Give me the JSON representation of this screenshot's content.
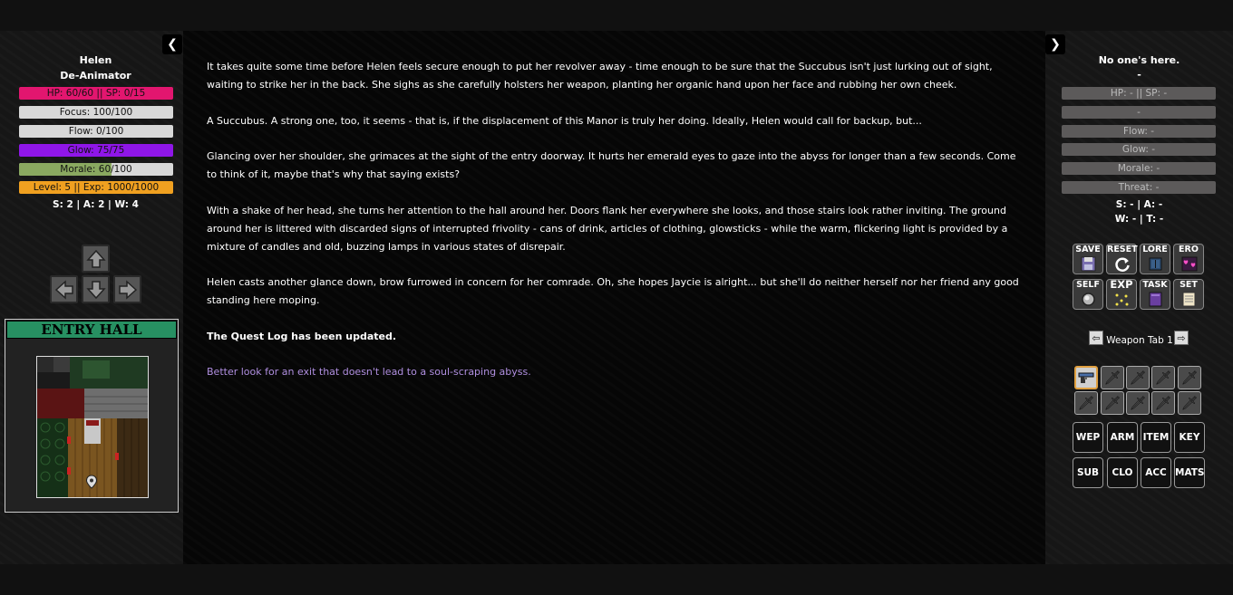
{
  "player": {
    "name": "Helen",
    "title": "De-Animator",
    "hp_sp": "HP: 60/60 || SP: 0/15",
    "focus": "Focus: 100/100",
    "flow": "Flow: 0/100",
    "glow": "Glow: 75/75",
    "morale": "Morale: 60/100",
    "level_exp": "Level: 5 || Exp: 1000/1000",
    "stats": "S: 2 | A: 2 | W: 4",
    "morale_fraction": 0.6,
    "colors": {
      "hp": "#e2166f",
      "focus": "#d8d8d8",
      "flow": "#d8d8d8",
      "glow": "#8f16e8",
      "morale": "#8aa960",
      "level": "#f0a020"
    }
  },
  "map": {
    "title": "ENTRY HALL"
  },
  "story": {
    "paragraphs": [
      "It takes quite some time before Helen feels secure enough to put her revolver away - time enough to be sure that the Succubus isn't just lurking out of sight, waiting to strike her in the back. She sighs as she carefully holsters her weapon, planting her organic hand upon her face and rubbing her own cheek.",
      "A Succubus. A strong one, too, it seems - that is, if the displacement of this Manor is truly her doing. Ideally, Helen would call for backup, but...",
      "Glancing over her shoulder, she grimaces at the sight of the entry doorway. It hurts her emerald eyes to gaze into the abyss for longer than a few seconds. Come to think of it, maybe that's why that saying exists?",
      "With a shake of her head, she turns her attention to the hall around her. Doors flank her everywhere she looks, and those stairs look rather inviting. The ground around her is littered with discarded signs of interrupted frivolity - cans of drink, articles of clothing, glowsticks - while the warm, flickering light is provided by a mixture of candles and old, buzzing lamps in various states of disrepair.",
      "Helen casts another glance down, brow furrowed in concern for her comrade. Oh, she hopes Jaycie is alright... but she'll do neither herself nor her friend any good standing here moping."
    ],
    "quest_notice": "The Quest Log has been updated.",
    "objective": "Better look for an exit that doesn't lead to a soul-scraping abyss."
  },
  "target": {
    "name": "No one's here.",
    "subtitle": "-",
    "hp_sp": "HP: - || SP: -",
    "blank": "-",
    "flow": "Flow: -",
    "glow": "Glow: -",
    "morale": "Morale: -",
    "threat": "Threat: -",
    "stats1": "S: - | A: -",
    "stats2": "W: - | T: -"
  },
  "menu": {
    "save": "SAVE",
    "reset": "RESET",
    "lore": "LORE",
    "ero": "ERO",
    "self": "SELF",
    "exp": "EXP",
    "task": "TASK",
    "set": "SET"
  },
  "weapon_tab": {
    "label": "Weapon Tab 1"
  },
  "categories": {
    "wep": "WEP",
    "arm": "ARM",
    "item": "ITEM",
    "key": "KEY",
    "sub": "SUB",
    "clo": "CLO",
    "acc": "ACC",
    "mats": "MATS"
  }
}
